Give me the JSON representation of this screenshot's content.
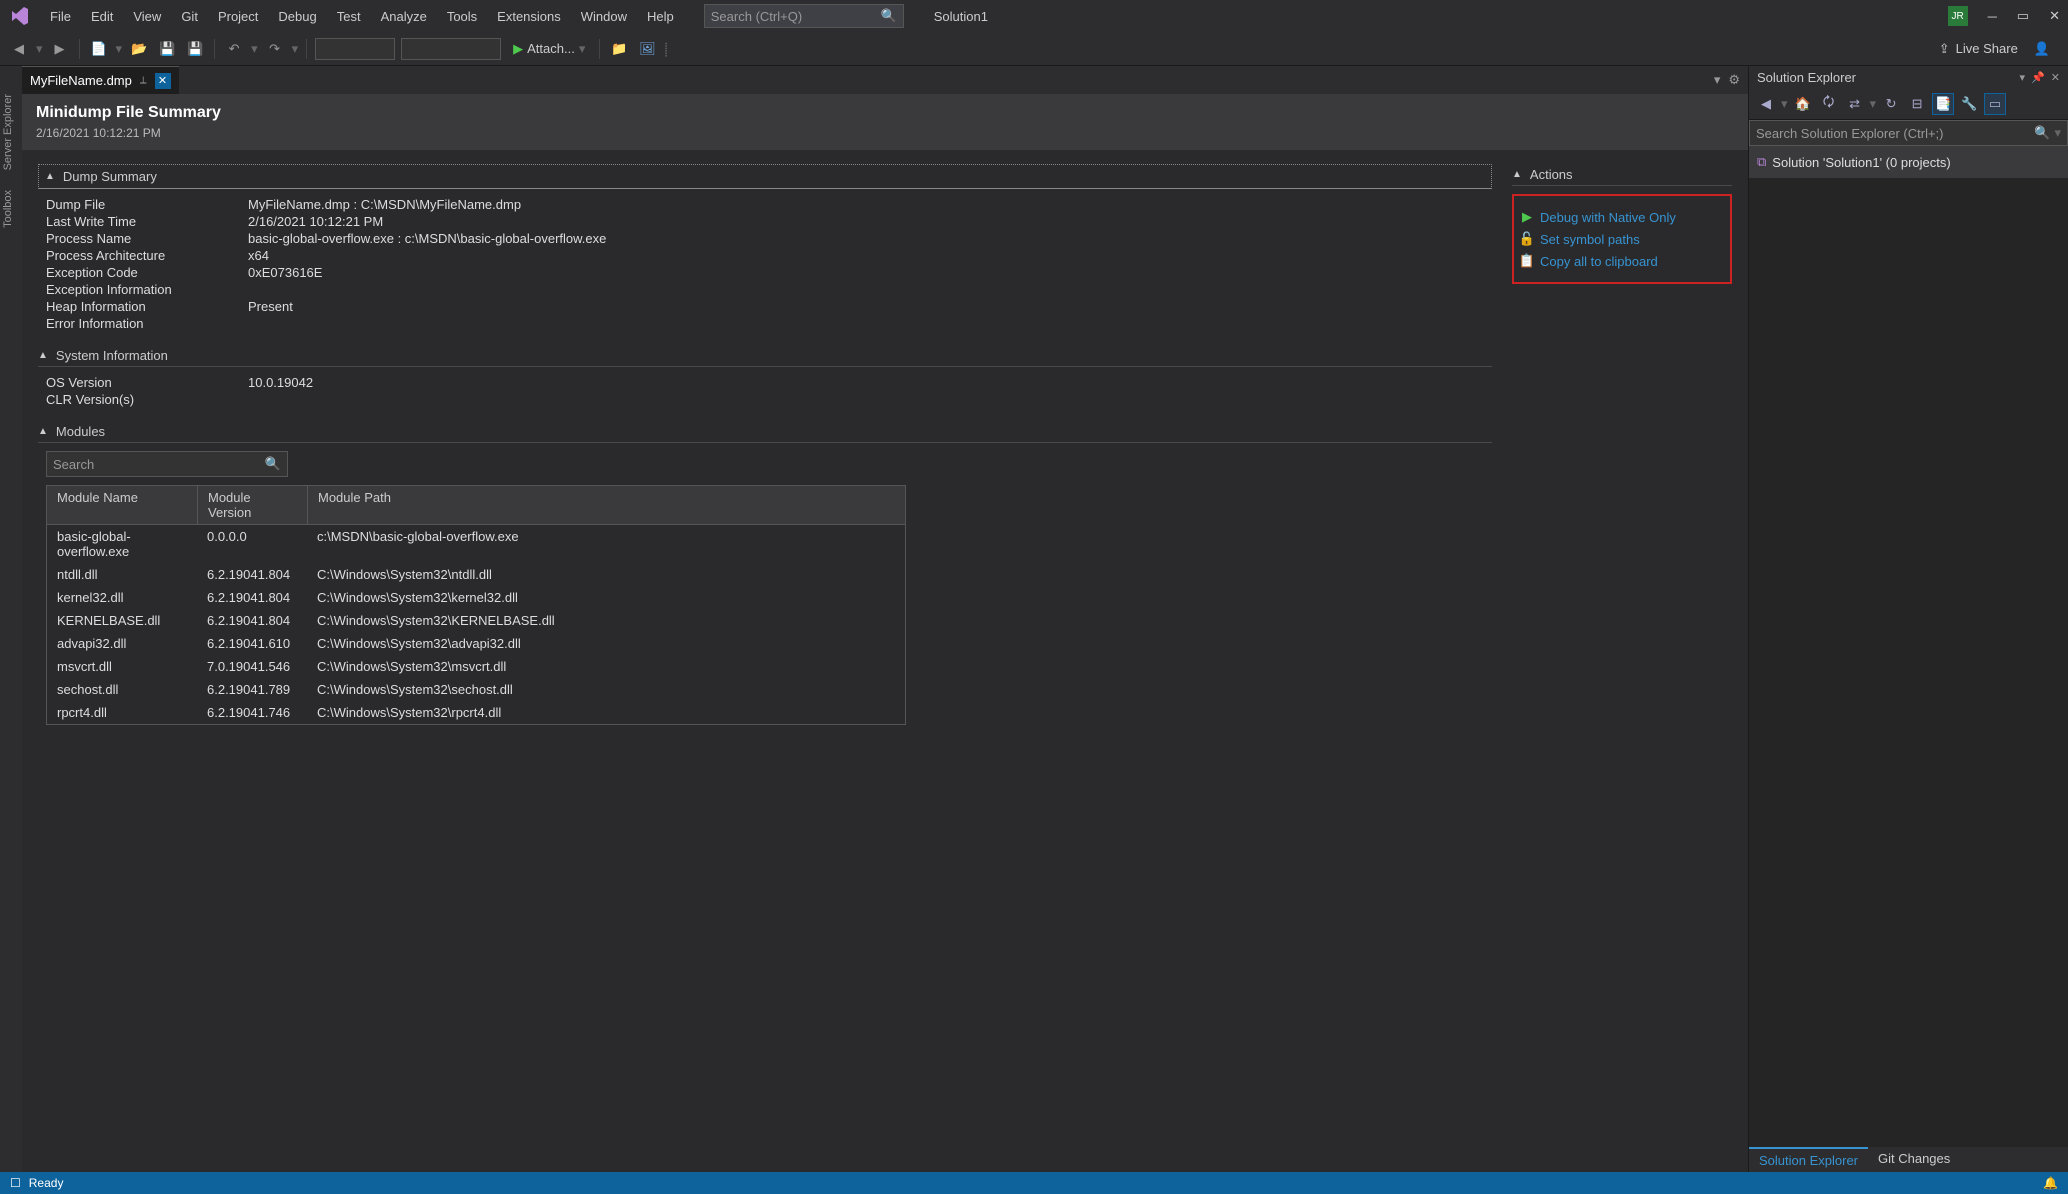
{
  "titlebar": {
    "menus": [
      "File",
      "Edit",
      "View",
      "Git",
      "Project",
      "Debug",
      "Test",
      "Analyze",
      "Tools",
      "Extensions",
      "Window",
      "Help"
    ],
    "search_placeholder": "Search (Ctrl+Q)",
    "solution": "Solution1",
    "avatar": "JR"
  },
  "toolbar": {
    "attach_label": "Attach...",
    "liveshare_label": "Live Share"
  },
  "leftdock": {
    "tabs": [
      "Server Explorer",
      "Toolbox"
    ]
  },
  "tab": {
    "filename": "MyFileName.dmp"
  },
  "doc": {
    "title": "Minidump File Summary",
    "timestamp": "2/16/2021 10:12:21 PM",
    "section_dump": "Dump Summary",
    "section_sys": "System Information",
    "section_mod": "Modules",
    "section_actions": "Actions",
    "kv": [
      {
        "k": "Dump File",
        "v": "MyFileName.dmp : C:\\MSDN\\MyFileName.dmp"
      },
      {
        "k": "Last Write Time",
        "v": "2/16/2021 10:12:21 PM"
      },
      {
        "k": "Process Name",
        "v": "basic-global-overflow.exe : c:\\MSDN\\basic-global-overflow.exe"
      },
      {
        "k": "Process Architecture",
        "v": "x64"
      },
      {
        "k": "Exception Code",
        "v": "0xE073616E"
      },
      {
        "k": "Exception Information",
        "v": ""
      },
      {
        "k": "Heap Information",
        "v": "Present"
      },
      {
        "k": "Error Information",
        "v": ""
      }
    ],
    "sys": [
      {
        "k": "OS Version",
        "v": "10.0.19042"
      },
      {
        "k": "CLR Version(s)",
        "v": ""
      }
    ],
    "mod_search_placeholder": "Search",
    "mod_cols": {
      "name": "Module Name",
      "ver": "Module Version",
      "path": "Module Path"
    },
    "modules": [
      {
        "name": "basic-global-overflow.exe",
        "ver": "0.0.0.0",
        "path": "c:\\MSDN\\basic-global-overflow.exe"
      },
      {
        "name": "ntdll.dll",
        "ver": "6.2.19041.804",
        "path": "C:\\Windows\\System32\\ntdll.dll"
      },
      {
        "name": "kernel32.dll",
        "ver": "6.2.19041.804",
        "path": "C:\\Windows\\System32\\kernel32.dll"
      },
      {
        "name": "KERNELBASE.dll",
        "ver": "6.2.19041.804",
        "path": "C:\\Windows\\System32\\KERNELBASE.dll"
      },
      {
        "name": "advapi32.dll",
        "ver": "6.2.19041.610",
        "path": "C:\\Windows\\System32\\advapi32.dll"
      },
      {
        "name": "msvcrt.dll",
        "ver": "7.0.19041.546",
        "path": "C:\\Windows\\System32\\msvcrt.dll"
      },
      {
        "name": "sechost.dll",
        "ver": "6.2.19041.789",
        "path": "C:\\Windows\\System32\\sechost.dll"
      },
      {
        "name": "rpcrt4.dll",
        "ver": "6.2.19041.746",
        "path": "C:\\Windows\\System32\\rpcrt4.dll"
      }
    ],
    "actions": [
      {
        "icon": "play",
        "label": "Debug with Native Only"
      },
      {
        "icon": "folder",
        "label": "Set symbol paths"
      },
      {
        "icon": "copy",
        "label": "Copy all to clipboard"
      }
    ]
  },
  "rightpanel": {
    "title": "Solution Explorer",
    "search_placeholder": "Search Solution Explorer (Ctrl+;)",
    "root": "Solution 'Solution1' (0 projects)",
    "bottom_tabs": [
      "Solution Explorer",
      "Git Changes"
    ]
  },
  "status": {
    "ready": "Ready"
  }
}
